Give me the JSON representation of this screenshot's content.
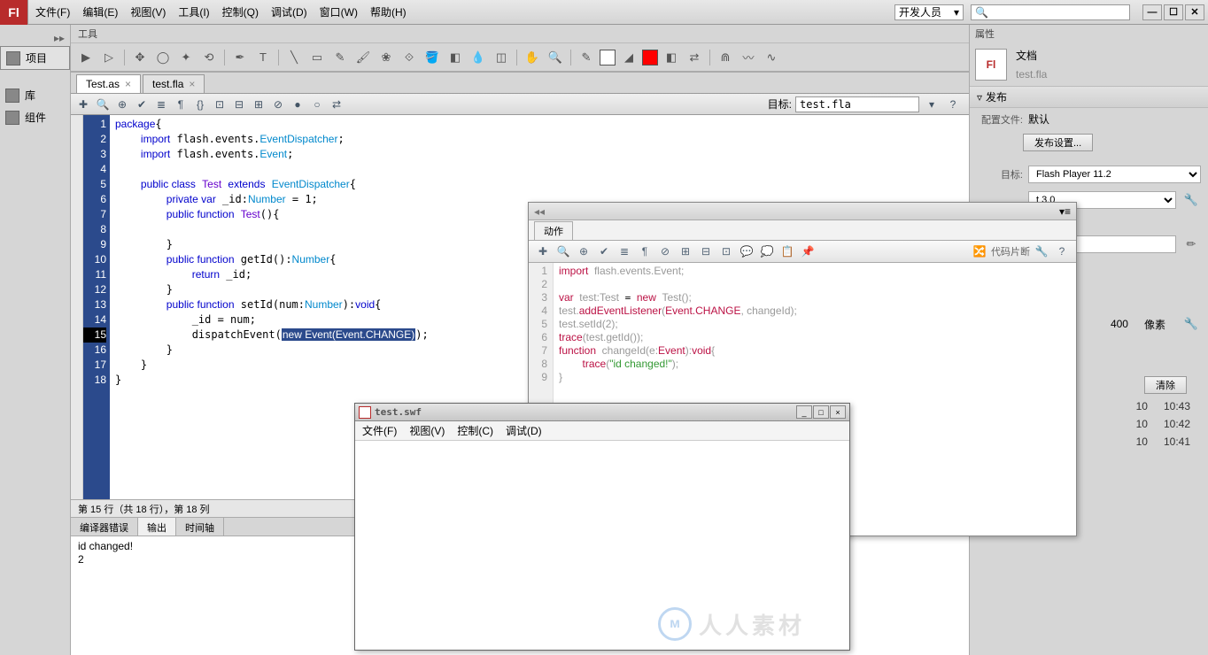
{
  "app": {
    "logo": "Fl"
  },
  "menu": [
    "文件(F)",
    "编辑(E)",
    "视图(V)",
    "工具(I)",
    "控制(Q)",
    "调试(D)",
    "窗口(W)",
    "帮助(H)"
  ],
  "workspace_label": "开发人员",
  "sidebar": [
    {
      "label": "项目"
    },
    {
      "label": "库"
    },
    {
      "label": "组件"
    }
  ],
  "tools_title": "工具",
  "tabs": [
    {
      "label": "Test.as",
      "active": true
    },
    {
      "label": "test.fla",
      "active": false
    }
  ],
  "target_label": "目标:",
  "target_value": "test.fla",
  "code": {
    "lines": [
      "1",
      "2",
      "3",
      "4",
      "5",
      "6",
      "7",
      "8",
      "9",
      "10",
      "11",
      "12",
      "13",
      "14",
      "15",
      "16",
      "17",
      "18"
    ],
    "status": "第 15 行（共 18 行），第 18 列"
  },
  "bottom_tabs": [
    "编译器错误",
    "输出",
    "时间轴"
  ],
  "output_lines": [
    "id changed!",
    "2"
  ],
  "right": {
    "prop_title": "属性",
    "doc_label": "文档",
    "doc_name": "test.fla",
    "publish_title": "发布",
    "config_label": "配置文件:",
    "config_value": "默认",
    "publish_btn": "发布设置...",
    "target_label": "目标:",
    "target_value": "Flash Player 11.2",
    "script_value": "t 3.0",
    "size_suffix": "像素",
    "size_h": "400",
    "clear_btn": "清除",
    "history": [
      {
        "a": "10",
        "b": "10:43"
      },
      {
        "a": "10",
        "b": "10:42"
      },
      {
        "a": "10",
        "b": "10:41"
      }
    ]
  },
  "actions_panel": {
    "tab": "动作",
    "code_hint": "代码片断",
    "lines": [
      "1",
      "2",
      "3",
      "4",
      "5",
      "6",
      "7",
      "8",
      "9"
    ]
  },
  "swf": {
    "title": "test.swf",
    "menu": [
      "文件(F)",
      "视图(V)",
      "控制(C)",
      "调试(D)"
    ]
  },
  "watermark": "人人素材"
}
